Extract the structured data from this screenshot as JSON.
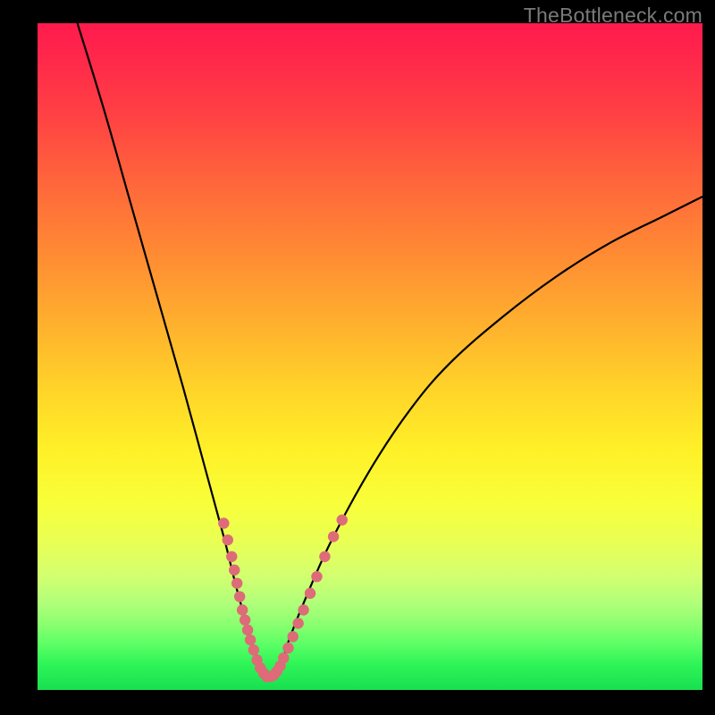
{
  "watermark": "TheBottleneck.com",
  "chart_data": {
    "type": "line",
    "title": "",
    "xlabel": "",
    "ylabel": "",
    "xlim": [
      0,
      100
    ],
    "ylim": [
      0,
      100
    ],
    "series": [
      {
        "name": "bottleneck-curve",
        "x": [
          6,
          10,
          14,
          18,
          22,
          25,
          28,
          30,
          32,
          33,
          34,
          35,
          36,
          37,
          38,
          40,
          44,
          50,
          56,
          62,
          70,
          78,
          86,
          94,
          100
        ],
        "y": [
          100,
          87,
          73,
          59,
          45,
          34,
          23,
          15,
          8,
          5,
          3,
          2,
          3,
          5,
          8,
          13,
          22,
          33,
          42,
          49,
          56,
          62,
          67,
          71,
          74
        ]
      }
    ],
    "markers": {
      "name": "highlight-dots",
      "color": "#dd6b78",
      "points": [
        {
          "x": 28.0,
          "y": 25.0
        },
        {
          "x": 28.6,
          "y": 22.5
        },
        {
          "x": 29.2,
          "y": 20.0
        },
        {
          "x": 29.6,
          "y": 18.0
        },
        {
          "x": 30.0,
          "y": 16.0
        },
        {
          "x": 30.4,
          "y": 14.0
        },
        {
          "x": 30.8,
          "y": 12.0
        },
        {
          "x": 31.2,
          "y": 10.5
        },
        {
          "x": 31.6,
          "y": 9.0
        },
        {
          "x": 32.0,
          "y": 7.5
        },
        {
          "x": 32.5,
          "y": 6.0
        },
        {
          "x": 33.0,
          "y": 4.5
        },
        {
          "x": 33.5,
          "y": 3.3
        },
        {
          "x": 34.0,
          "y": 2.5
        },
        {
          "x": 34.5,
          "y": 2.0
        },
        {
          "x": 35.0,
          "y": 2.0
        },
        {
          "x": 35.5,
          "y": 2.2
        },
        {
          "x": 36.0,
          "y": 2.8
        },
        {
          "x": 36.5,
          "y": 3.6
        },
        {
          "x": 37.0,
          "y": 4.8
        },
        {
          "x": 37.7,
          "y": 6.3
        },
        {
          "x": 38.4,
          "y": 8.0
        },
        {
          "x": 39.2,
          "y": 10.0
        },
        {
          "x": 40.0,
          "y": 12.0
        },
        {
          "x": 41.0,
          "y": 14.5
        },
        {
          "x": 42.0,
          "y": 17.0
        },
        {
          "x": 43.2,
          "y": 20.0
        },
        {
          "x": 44.5,
          "y": 23.0
        },
        {
          "x": 45.8,
          "y": 25.5
        }
      ]
    },
    "gradient_stops": [
      {
        "pos": 0.0,
        "color": "#ff1a4d"
      },
      {
        "pos": 0.35,
        "color": "#ff8c33"
      },
      {
        "pos": 0.65,
        "color": "#fff028"
      },
      {
        "pos": 0.9,
        "color": "#8cff70"
      },
      {
        "pos": 1.0,
        "color": "#18df50"
      }
    ]
  }
}
